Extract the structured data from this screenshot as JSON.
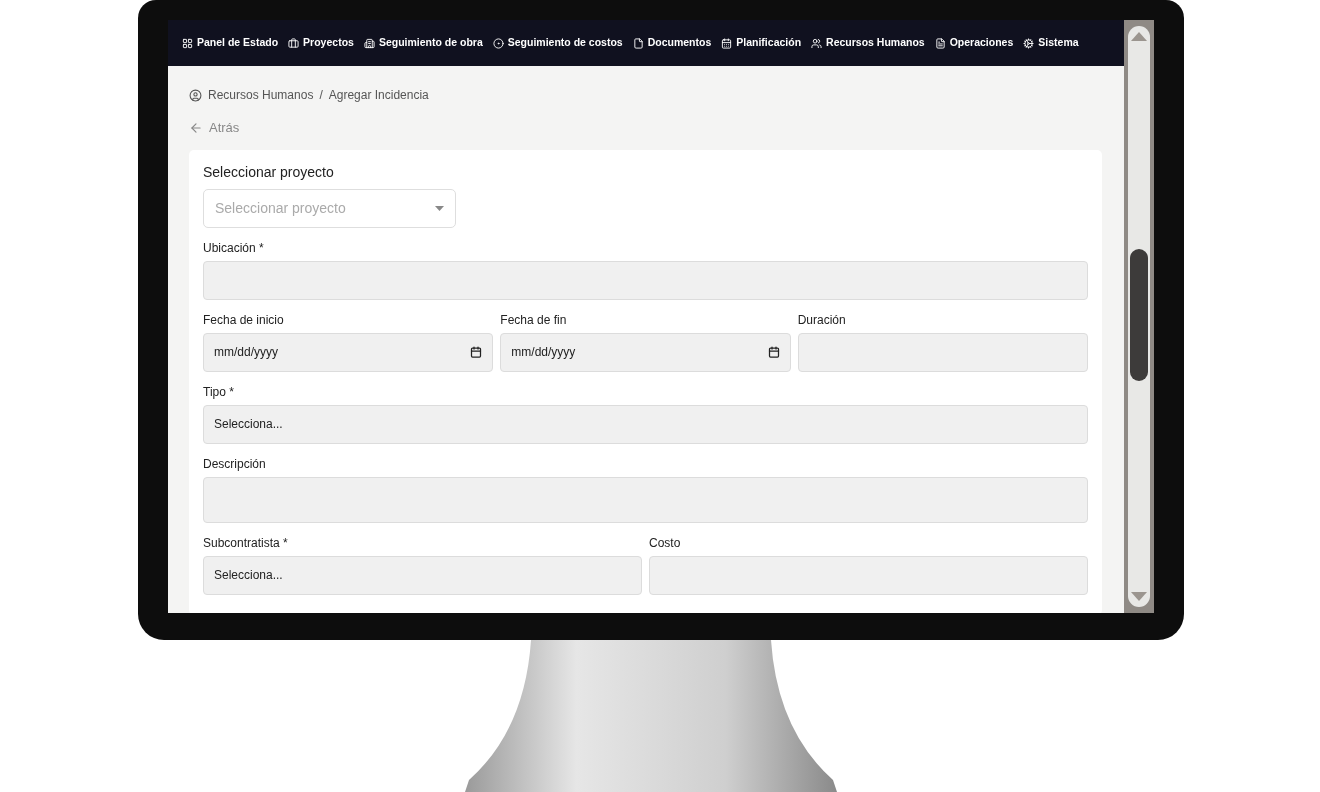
{
  "nav": {
    "items": [
      {
        "label": "Panel de Estado"
      },
      {
        "label": "Proyectos"
      },
      {
        "label": "Seguimiento de obra"
      },
      {
        "label": "Seguimiento de costos"
      },
      {
        "label": "Documentos"
      },
      {
        "label": "Planificación"
      },
      {
        "label": "Recursos Humanos"
      },
      {
        "label": "Operaciones"
      },
      {
        "label": "Sistema"
      }
    ]
  },
  "breadcrumb": [
    "Recursos Humanos",
    "Agregar Incidencia"
  ],
  "breadcrumb_separator": "/",
  "back_link": "Atrás",
  "form": {
    "project": {
      "label": "Seleccionar proyecto",
      "placeholder": "Seleccionar proyecto"
    },
    "rows": [
      {
        "fields": [
          {
            "kind": "text",
            "label": "Ubicación *"
          }
        ]
      },
      {
        "fields": [
          {
            "kind": "date",
            "label": "Fecha de inicio",
            "placeholder": "mm/dd/yyyy"
          },
          {
            "kind": "date",
            "label": "Fecha de fin",
            "placeholder": "mm/dd/yyyy"
          },
          {
            "kind": "text",
            "label": "Duración"
          }
        ]
      },
      {
        "fields": [
          {
            "kind": "select",
            "label": "Tipo *",
            "value": "Selecciona..."
          }
        ]
      },
      {
        "fields": [
          {
            "kind": "textarea",
            "label": "Descripción"
          }
        ]
      },
      {
        "fields": [
          {
            "kind": "select",
            "label": "Subcontratista *",
            "value": "Selecciona..."
          },
          {
            "kind": "text",
            "label": "Costo"
          }
        ]
      }
    ]
  }
}
